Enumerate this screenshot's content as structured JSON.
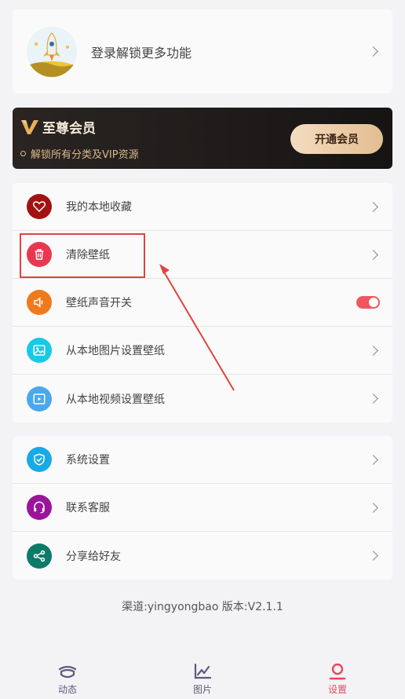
{
  "login": {
    "text": "登录解锁更多功能"
  },
  "vip": {
    "title": "至尊会员",
    "subtitle": "解锁所有分类及VIP资源",
    "button": "开通会员"
  },
  "group1": [
    {
      "label": "我的本地收藏",
      "icon": "heart-icon",
      "color": "#a31212"
    },
    {
      "label": "清除壁纸",
      "icon": "trash-icon",
      "color": "#e8384f"
    },
    {
      "label": "壁纸声音开关",
      "icon": "speaker-icon",
      "color": "#f07a1b",
      "toggle": true
    },
    {
      "label": "从本地图片设置壁纸",
      "icon": "image-icon",
      "color": "#18c9e8"
    },
    {
      "label": "从本地视频设置壁纸",
      "icon": "video-icon",
      "color": "#4aa8ee"
    }
  ],
  "group2": [
    {
      "label": "系统设置",
      "icon": "shield-check-icon",
      "color": "#1aa9e6"
    },
    {
      "label": "联系客服",
      "icon": "headset-icon",
      "color": "#9a1599"
    },
    {
      "label": "分享给好友",
      "icon": "share-icon",
      "color": "#0c7a68"
    }
  ],
  "version": "渠道:yingyongbao  版本:V2.1.1",
  "tabs": [
    {
      "label": "动态",
      "active": false
    },
    {
      "label": "图片",
      "active": false
    },
    {
      "label": "设置",
      "active": true
    }
  ],
  "colors": {
    "accent": "#e64a5e",
    "highlight": "#e0443c"
  }
}
